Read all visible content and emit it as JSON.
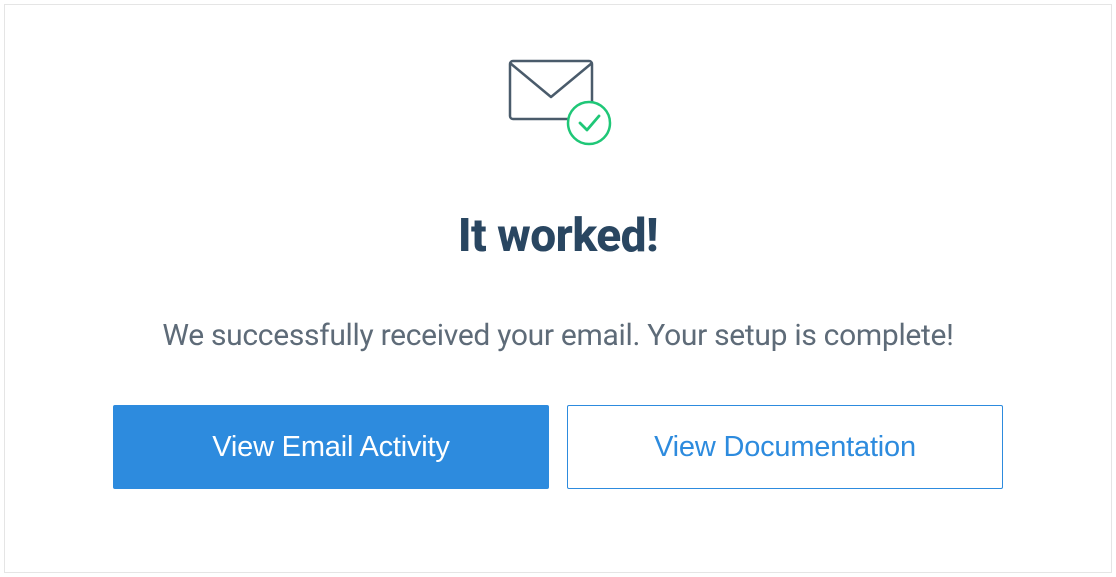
{
  "heading": "It worked!",
  "subtext": "We successfully received your email. Your setup is complete!",
  "buttons": {
    "primary": "View Email Activity",
    "secondary": "View Documentation"
  }
}
